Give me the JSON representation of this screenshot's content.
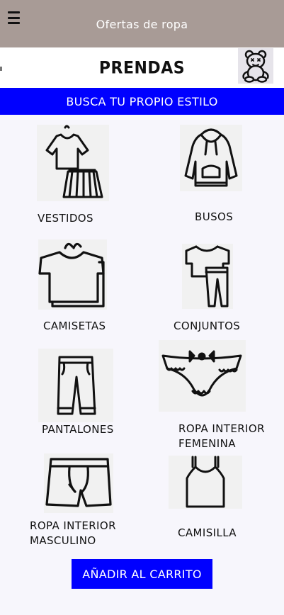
{
  "appbar": {
    "title": "Ofertas de ropa",
    "menu_icon": "menu-icon"
  },
  "page": {
    "title": "PRENDAS",
    "avatar_icon": "teddy-bear-avatar"
  },
  "banner": {
    "text": "BUSCA TU PROPIO ESTILO"
  },
  "categories": [
    {
      "label": "VESTIDOS",
      "icon": "dress-icon"
    },
    {
      "label": "BUSOS",
      "icon": "hoodie-icon"
    },
    {
      "label": "CAMISETAS",
      "icon": "tshirt-icon"
    },
    {
      "label": "CONJUNTOS",
      "icon": "outfit-icon"
    },
    {
      "label": "PANTALONES",
      "icon": "pants-icon"
    },
    {
      "label": "ROPA INTERIOR\nFEMENINA",
      "icon": "panties-icon"
    },
    {
      "label": "ROPA INTERIOR\nMASCULINO",
      "icon": "boxers-icon"
    },
    {
      "label": "CAMISILLA",
      "icon": "tank-top-icon"
    }
  ],
  "cart_button": {
    "label": "AÑADIR AL CARRITO"
  },
  "colors": {
    "appbar": "#a89b96",
    "accent": "#0000ff",
    "background": "#f7f6fc"
  }
}
